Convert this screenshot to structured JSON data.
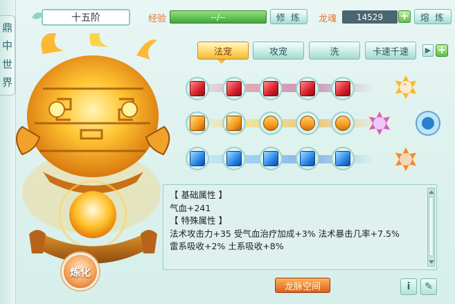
{
  "side_tab": {
    "chars": [
      "鼎",
      "中",
      "世",
      "界"
    ]
  },
  "header": {
    "rank_title": "十五阶",
    "exp_label": "经验",
    "exp_value": "--/--",
    "cultivate_button": "修 炼",
    "soul_label": "龙魂",
    "soul_value": "14529",
    "smelt_button": "熔 炼"
  },
  "tabs": [
    {
      "label": "法宠",
      "active": true
    },
    {
      "label": "攻宠",
      "active": false
    },
    {
      "label": "洗",
      "active": false
    },
    {
      "label": "卡速千速",
      "active": false
    }
  ],
  "gem_rows": [
    {
      "color": "red",
      "count": 5
    },
    {
      "color": "orange",
      "count": 5
    },
    {
      "color": "blue",
      "count": 5
    }
  ],
  "attributes": {
    "basic_header": "【 基础属性 】",
    "basic_line": "气血+241",
    "special_header": "【 特殊属性 】",
    "special_line1": "法术攻击力+35  受气血治疗加成+3%  法术暴击几率+7.5%",
    "special_line2": "雷系吸收+2%  土系吸收+8%"
  },
  "footer": {
    "dragon_space_button": "龙脉空间",
    "refine_button": "炼化",
    "info_icon": "i",
    "edit_icon": "✎"
  },
  "colors": {
    "accent_orange": "#e0782a",
    "mint": "#a9dcd3",
    "gold": "#f2b93a"
  }
}
